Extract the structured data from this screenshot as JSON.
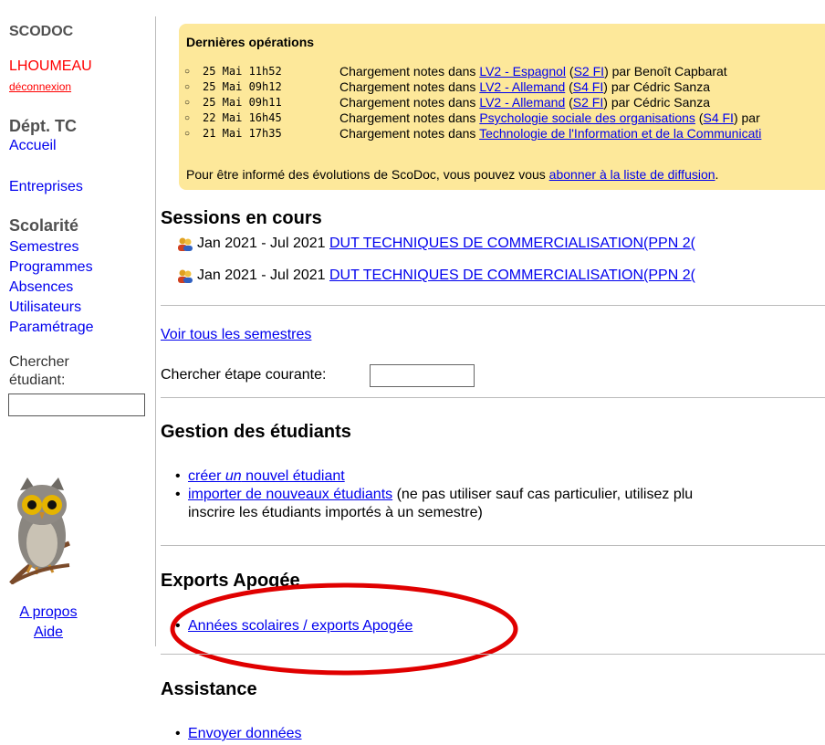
{
  "sidebar": {
    "title": "SCODOC",
    "user": "LHOUMEAU",
    "logout": "déconnexion",
    "dept": "Dépt. TC",
    "accueil": "Accueil",
    "entreprises": "Entreprises",
    "scolarite": "Scolarité",
    "links": [
      "Semestres",
      "Programmes",
      "Absences",
      "Utilisateurs",
      "Paramétrage"
    ],
    "search_label": "Chercher étudiant:",
    "about": "A propos",
    "help": "Aide"
  },
  "ops": {
    "title": "Dernières opérations",
    "items": [
      {
        "date": "25 Mai 11h52",
        "prefix": "Chargement notes dans ",
        "link": "LV2 - Espagnol",
        "open": " (",
        "sem": "S2 FI",
        "suffix": ") par Benoît Capbarat"
      },
      {
        "date": "25 Mai 09h12",
        "prefix": "Chargement notes dans ",
        "link": "LV2 - Allemand",
        "open": " (",
        "sem": "S4 FI",
        "suffix": ") par Cédric Sanza"
      },
      {
        "date": "25 Mai 09h11",
        "prefix": "Chargement notes dans ",
        "link": "LV2 - Allemand",
        "open": " (",
        "sem": "S2 FI",
        "suffix": ") par Cédric Sanza"
      },
      {
        "date": "22 Mai 16h45",
        "prefix": "Chargement notes dans ",
        "link": "Psychologie sociale des organisations",
        "open": " (",
        "sem": "S4 FI",
        "suffix": ") par"
      },
      {
        "date": "21 Mai 17h35",
        "prefix": "Chargement notes dans ",
        "link": "Technologie de l'Information et de la Communicati",
        "open": "",
        "sem": "",
        "suffix": ""
      }
    ],
    "note_prefix": "Pour être informé des évolutions de ScoDoc, vous pouvez vous ",
    "note_link": "abonner à la liste de diffusion",
    "note_suffix": "."
  },
  "sessions": {
    "title": "Sessions en cours",
    "items": [
      {
        "period": "Jan 2021 - Jul 2021 ",
        "name": "DUT TECHNIQUES DE COMMERCIALISATION(PPN 2("
      },
      {
        "period": "Jan 2021 - Jul 2021 ",
        "name": "DUT TECHNIQUES DE COMMERCIALISATION(PPN 2("
      }
    ]
  },
  "voir_tous": "Voir tous les semestres",
  "chercher_etape": "Chercher étape courante:",
  "gestion": {
    "title": "Gestion des étudiants",
    "create_1": "créer ",
    "create_em": "un",
    "create_2": " nouvel étudiant",
    "import_link": "importer de nouveaux étudiants",
    "import_rest": " (ne pas utiliser sauf cas particulier, utilisez plu",
    "import_line2": "inscrire les étudiants importés à un semestre)"
  },
  "exports": {
    "title": "Exports Apogée",
    "link": "Années scolaires / exports Apogée"
  },
  "assistance": {
    "title": "Assistance",
    "link": "Envoyer données"
  },
  "colors": {
    "ops_bg": "#fde89a",
    "link": "#0000ee",
    "user": "#ff0000",
    "annotation": "#e00000"
  }
}
